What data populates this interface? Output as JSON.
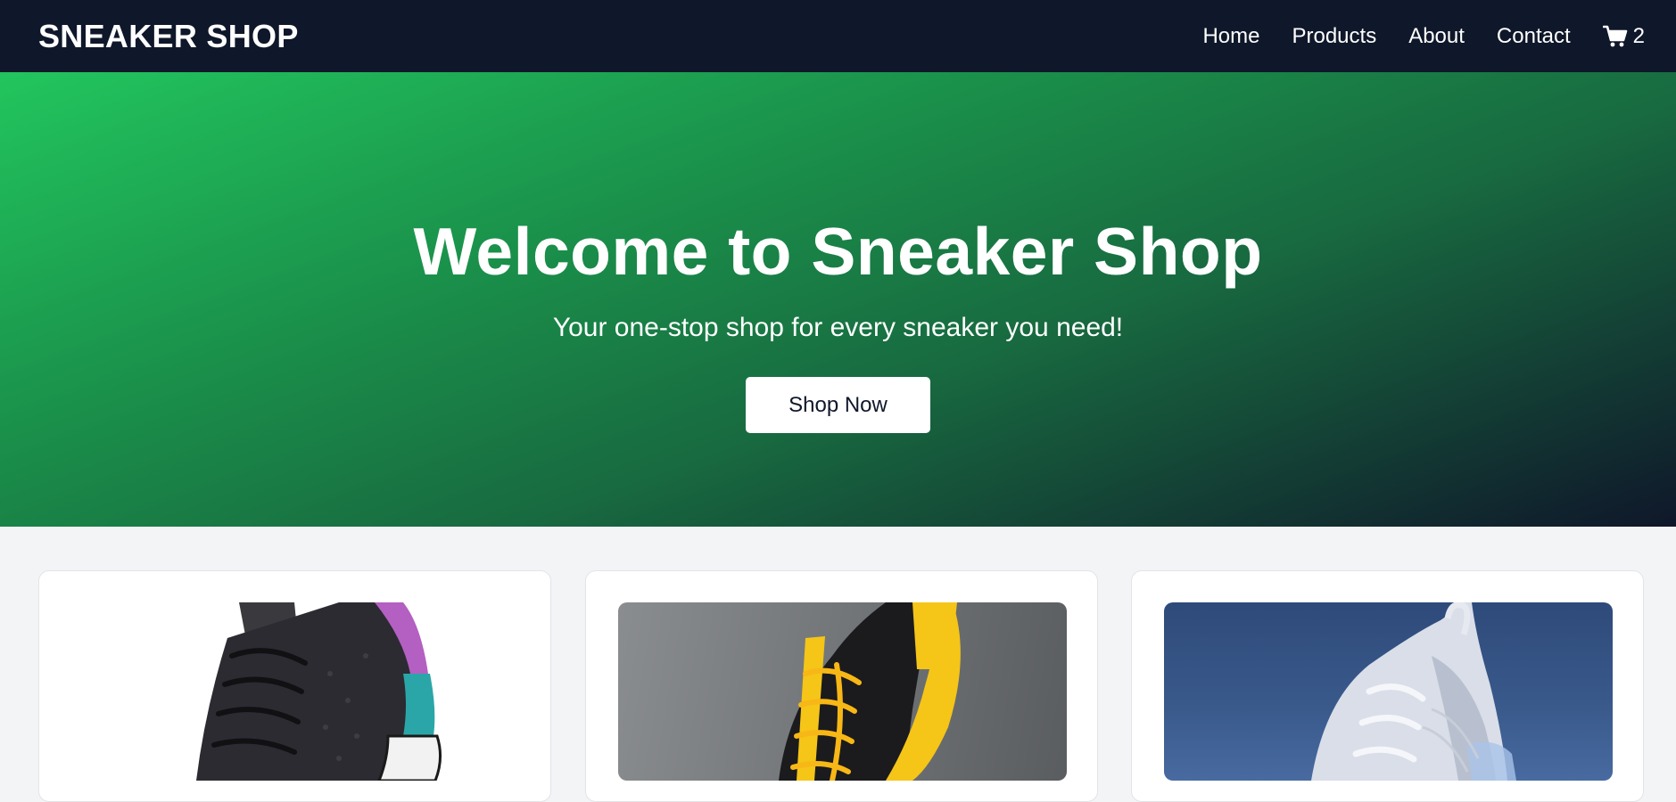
{
  "brand": {
    "logo": "SNEAKER SHOP"
  },
  "nav": {
    "links": [
      "Home",
      "Products",
      "About",
      "Contact"
    ],
    "cart_count": "2"
  },
  "hero": {
    "title": "Welcome to Sneaker Shop",
    "subtitle": "Your one-stop shop for every sneaker you need!",
    "cta_label": "Shop Now"
  },
  "products": [
    {
      "image": "black-purple-teal-sneaker"
    },
    {
      "image": "black-yellow-sneaker"
    },
    {
      "image": "white-air-sneaker"
    }
  ],
  "colors": {
    "navbar": "#0f172a",
    "hero_start": "#22c55e",
    "hero_end": "#0f172a",
    "page_bg": "#f3f4f6"
  },
  "icons": {
    "cart": "cart-icon"
  }
}
